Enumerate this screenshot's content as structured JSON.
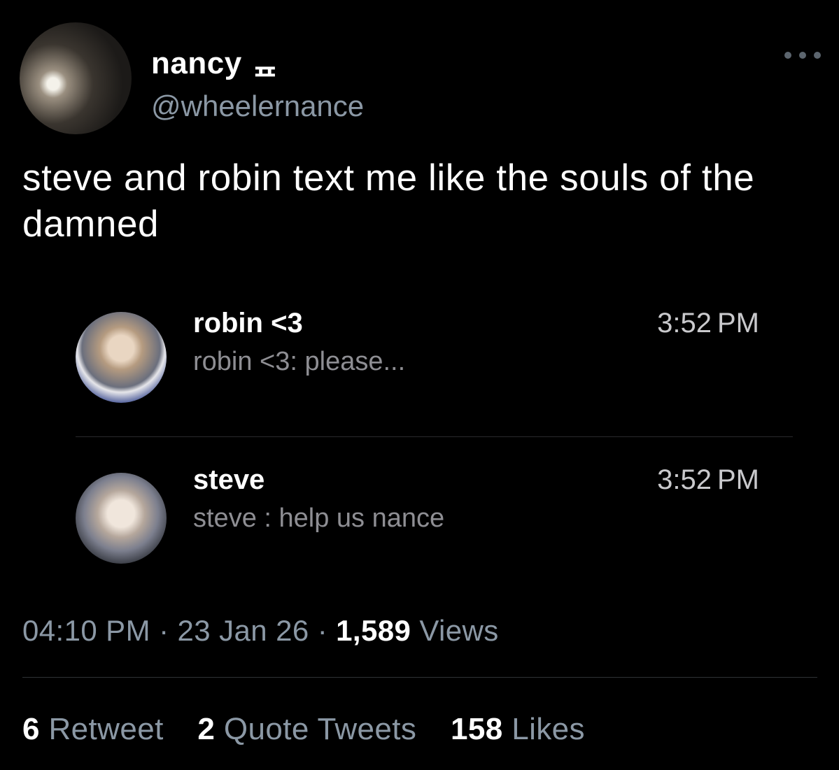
{
  "author": {
    "name": "nancy ᇁ",
    "handle": "@wheelernance"
  },
  "tweet": {
    "text": "steve and robin text me like the souls of the damned"
  },
  "conversations": [
    {
      "name": "robin <3",
      "preview": "robin <3: please...",
      "time": "3:52 PM"
    },
    {
      "name": "steve",
      "preview": "steve : help us nance",
      "time": "3:52 PM"
    }
  ],
  "meta": {
    "time": "04:10 PM",
    "separator": "·",
    "date": "23 Jan 26",
    "views_count": "1,589",
    "views_label": "Views"
  },
  "stats": {
    "retweets_count": "6",
    "retweets_label": "Retweet",
    "quotes_count": "2",
    "quotes_label": "Quote Tweets",
    "likes_count": "158",
    "likes_label": "Likes"
  }
}
